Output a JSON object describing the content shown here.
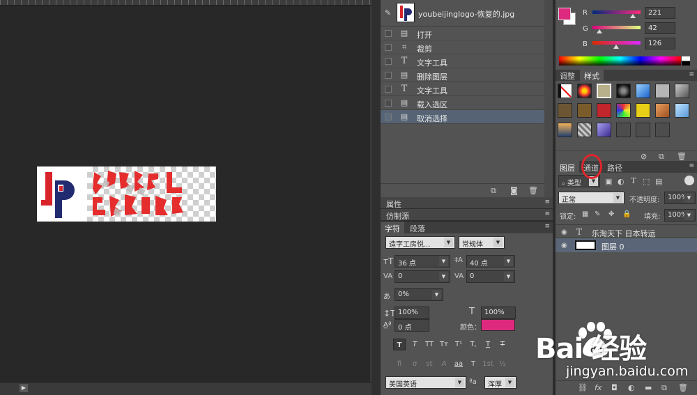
{
  "history": {
    "snapshot_name": "youbeijinglogo-恢复的.jpg",
    "items": [
      {
        "label": "打开",
        "icon": "document-icon",
        "selected": false
      },
      {
        "label": "裁剪",
        "icon": "crop-icon",
        "selected": false
      },
      {
        "label": "文字工具",
        "icon": "type-icon",
        "selected": false
      },
      {
        "label": "删除图层",
        "icon": "document-icon",
        "selected": false
      },
      {
        "label": "文字工具",
        "icon": "type-icon",
        "selected": false
      },
      {
        "label": "载入选区",
        "icon": "document-icon",
        "selected": false
      },
      {
        "label": "取消选择",
        "icon": "document-icon",
        "selected": true
      }
    ]
  },
  "panels": {
    "properties": "属性",
    "clone_source": "仿制源"
  },
  "character": {
    "tab_char": "字符",
    "tab_para": "段落",
    "font_family": "造字工房悦...",
    "font_style": "常规体",
    "font_size": "36 点",
    "leading": "40 点",
    "kerning": "0",
    "tracking": "0",
    "tsume": "0%",
    "vscale": "100%",
    "hscale": "100%",
    "baseline": "0 点",
    "color_label": "颜色：",
    "text_color": "#dd2a7e",
    "language": "美国英语",
    "aa_label": "a",
    "antialias": "浑厚",
    "type_buttons": [
      "T",
      "T",
      "TT",
      "Tт",
      "T¹",
      "T,",
      "T",
      "T"
    ],
    "ot_buttons": [
      "fi",
      "σ",
      "st",
      "A",
      "aa",
      "T",
      "1st",
      "½"
    ]
  },
  "color": {
    "r_label": "R",
    "g_label": "G",
    "b_label": "B",
    "r": "221",
    "g": "42",
    "b": "126",
    "foreground": "#dd2a7e"
  },
  "styles": {
    "tab_adjust": "调整",
    "tab_styles": "样式"
  },
  "layers": {
    "tab_layers": "图层",
    "tab_channels": "通道",
    "tab_paths": "路径",
    "filter_kind": "类型",
    "blend_mode": "正常",
    "opacity_label": "不透明度:",
    "opacity": "100%",
    "lock_label": "锁定:",
    "fill_label": "填充:",
    "fill": "100%",
    "items": [
      {
        "name": "乐淘天下 日本转运",
        "type": "text"
      },
      {
        "name": "图层 0",
        "type": "pixel"
      }
    ]
  },
  "watermark": {
    "logo": "Bai  经验",
    "url": "jingyan.baidu.com"
  },
  "document": {
    "logo_text": "JP"
  }
}
